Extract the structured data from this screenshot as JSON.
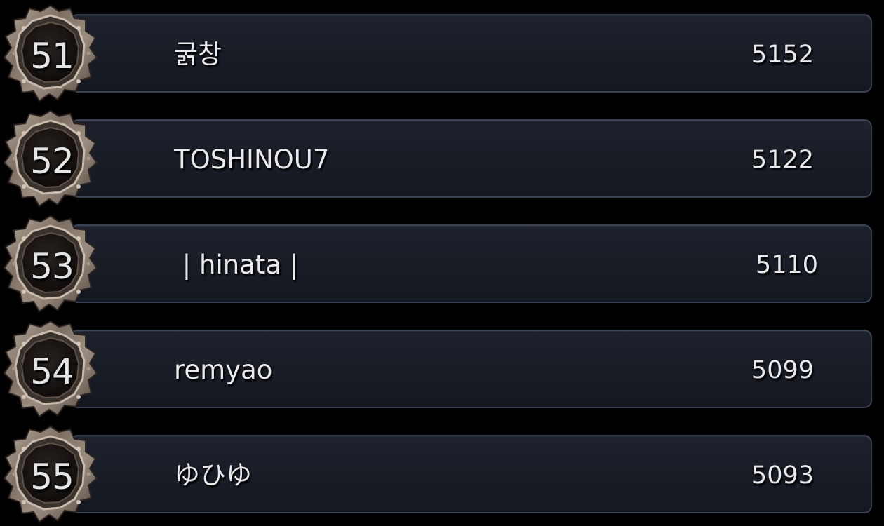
{
  "leaderboard": {
    "entries": [
      {
        "rank": "51",
        "name": "굵창",
        "score": "5152"
      },
      {
        "rank": "52",
        "name": "TOSHINOU7",
        "score": "5122"
      },
      {
        "rank": "53",
        "name": " | hinata |",
        "score": "5110"
      },
      {
        "rank": "54",
        "name": "remyao",
        "score": "5099"
      },
      {
        "rank": "55",
        "name": "ゆひゆ",
        "score": "5093"
      }
    ]
  },
  "colors": {
    "background": "#000000",
    "bar_fill": "#1a1f29",
    "bar_border": "#3a4152",
    "text": "#e9e9ec",
    "badge_metal": "#8a7c70",
    "badge_core": "#161210"
  },
  "icons": {
    "rank_badge": "ornate-metal-frame-icon"
  }
}
